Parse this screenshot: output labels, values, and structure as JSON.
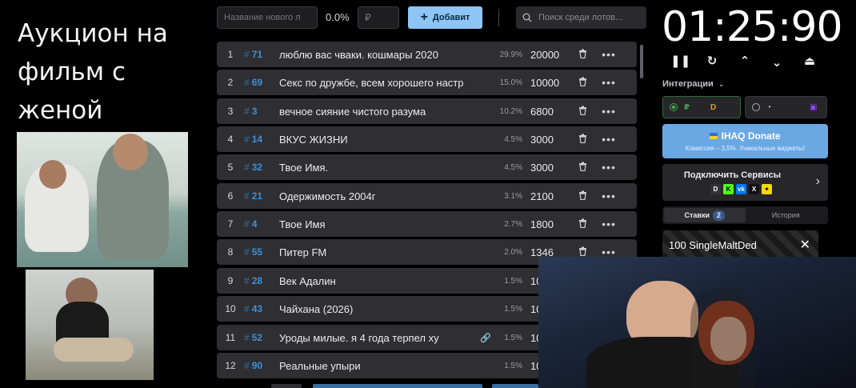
{
  "stream": {
    "title": "Аукцион на фильм с женой"
  },
  "toolbar": {
    "name_placeholder": "Название нового л",
    "percent": "0.0%",
    "price_placeholder": "₽",
    "add_label": "Добавит",
    "search_placeholder": "Поиск среди лотов..."
  },
  "lots": [
    {
      "num": "1",
      "id": "71",
      "title": "люблю вас чваки. кошмары 2020",
      "pct": "29.9%",
      "amount": "20000"
    },
    {
      "num": "2",
      "id": "69",
      "title": "Секс по дружбе, всем хорошего настр",
      "pct": "15.0%",
      "amount": "10000"
    },
    {
      "num": "3",
      "id": "3",
      "title": "вечное сияние чистого разума",
      "pct": "10.2%",
      "amount": "6800"
    },
    {
      "num": "4",
      "id": "14",
      "title": "ВКУС ЖИЗНИ",
      "pct": "4.5%",
      "amount": "3000"
    },
    {
      "num": "5",
      "id": "32",
      "title": "Твое Имя.",
      "pct": "4.5%",
      "amount": "3000"
    },
    {
      "num": "6",
      "id": "21",
      "title": "Одержимость 2004г",
      "pct": "3.1%",
      "amount": "2100"
    },
    {
      "num": "7",
      "id": "4",
      "title": "Твое Имя",
      "pct": "2.7%",
      "amount": "1800"
    },
    {
      "num": "8",
      "id": "55",
      "title": "Питер FM",
      "pct": "2.0%",
      "amount": "1346"
    },
    {
      "num": "9",
      "id": "28",
      "title": "Век Адалин",
      "pct": "1.5%",
      "amount": "100"
    },
    {
      "num": "10",
      "id": "43",
      "title": "Чайхана (2026)",
      "pct": "1.5%",
      "amount": "100"
    },
    {
      "num": "11",
      "id": "52",
      "title": "Уроды милые. я 4 года терпел ху",
      "pct": "1.5%",
      "amount": "100"
    },
    {
      "num": "12",
      "id": "90",
      "title": "Реальные упыри",
      "pct": "1.5%",
      "amount": "100"
    }
  ],
  "timer": {
    "value": "01:25:90"
  },
  "integrations": {
    "label": "Интеграции"
  },
  "donate_banner": {
    "title": "IHAQ Donate",
    "subtitle": "Комиссия – 3,5%. Уникальные виджеты!"
  },
  "connect": {
    "title": "Подключить Сервисы"
  },
  "tabs": {
    "bids_label": "Ставки",
    "bids_count": "2",
    "history_label": "История"
  },
  "bid": {
    "text": "100 SingleMaltDed"
  },
  "colors": {
    "accent": "#8ec5f5",
    "lot_id": "#3f8fd6",
    "row_bg": "#2f2f33",
    "donate_bg": "#6aa8e4"
  }
}
